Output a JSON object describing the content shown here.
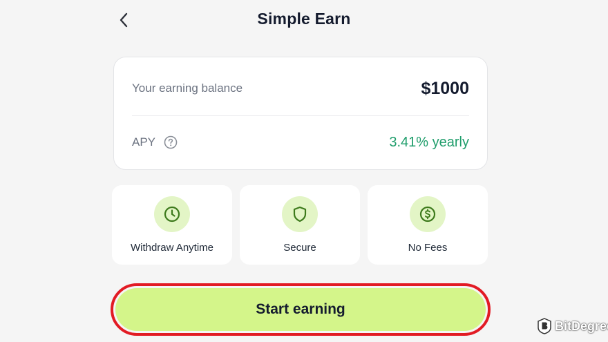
{
  "header": {
    "title": "Simple Earn",
    "back_icon": "chevron-left-icon"
  },
  "balance_card": {
    "balance_label": "Your earning balance",
    "balance_value": "$1000",
    "apy_label": "APY",
    "apy_help_icon": "question-circle-icon",
    "apy_value": "3.41% yearly"
  },
  "features": [
    {
      "label": "Withdraw Anytime",
      "icon": "clock-icon"
    },
    {
      "label": "Secure",
      "icon": "shield-icon"
    },
    {
      "label": "No Fees",
      "icon": "dollar-circle-icon"
    }
  ],
  "cta": {
    "label": "Start earning",
    "highlight_color": "#e21b24"
  },
  "colors": {
    "accent": "#d4f58a",
    "apy_green": "#1f9d6b",
    "icon_bg": "#e3f5c6",
    "icon_stroke": "#3d7a1c"
  },
  "watermark": {
    "text": "BitDegree"
  }
}
